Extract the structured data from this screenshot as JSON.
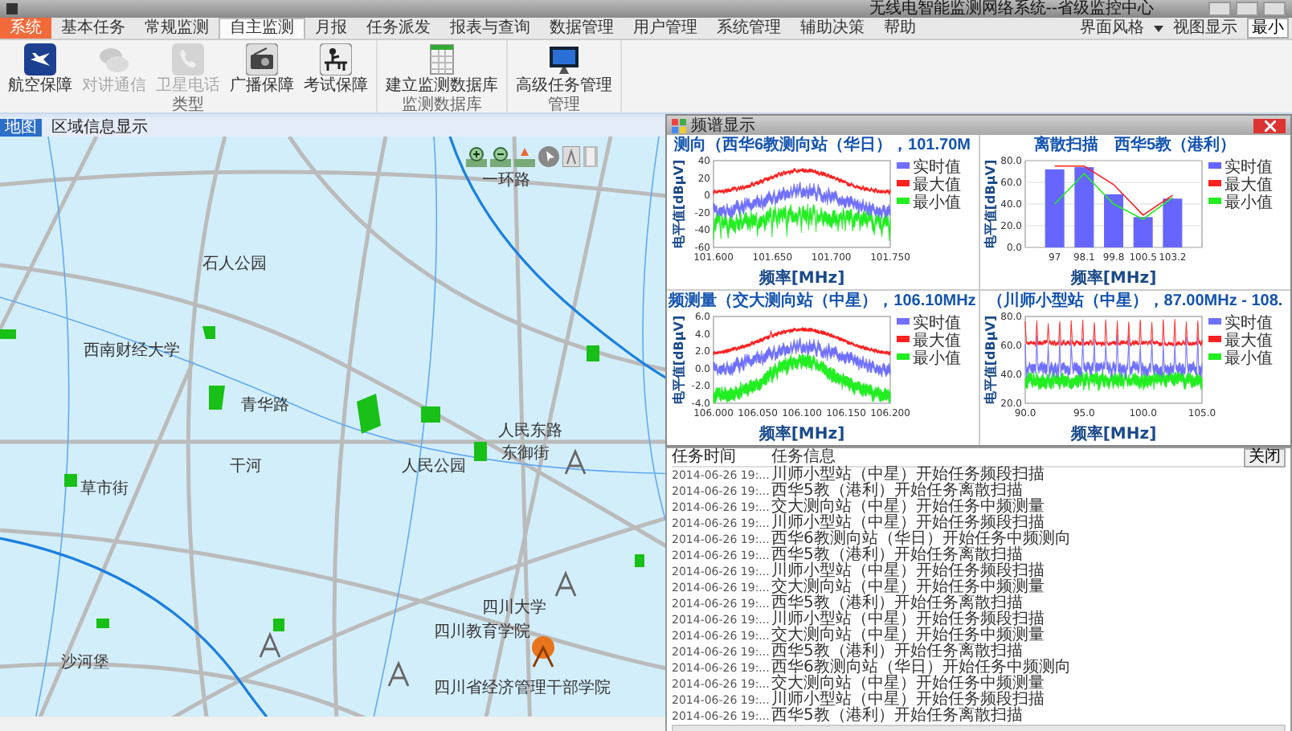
{
  "window": {
    "title": "无线电智能监测网络系统--省级监控中心"
  },
  "menu_tabs": [
    {
      "label": "系统",
      "kind": "app",
      "selected": false
    },
    {
      "label": "基本任务",
      "kind": "tab",
      "selected": false
    },
    {
      "label": "常规监测",
      "kind": "tab",
      "selected": false
    },
    {
      "label": "自主监测",
      "kind": "tab",
      "selected": true
    },
    {
      "label": "月报",
      "kind": "tab",
      "selected": false
    },
    {
      "label": "任务派发",
      "kind": "tab",
      "selected": false
    },
    {
      "label": "报表与查询",
      "kind": "tab",
      "selected": false
    },
    {
      "label": "数据管理",
      "kind": "tab",
      "selected": false
    },
    {
      "label": "用户管理",
      "kind": "tab",
      "selected": false
    },
    {
      "label": "系统管理",
      "kind": "tab",
      "selected": false
    },
    {
      "label": "辅助决策",
      "kind": "tab",
      "selected": false
    },
    {
      "label": "帮助",
      "kind": "tab",
      "selected": false
    }
  ],
  "toolbar_right": {
    "style_menu": "界面风格",
    "view_menu": "视图显示",
    "minimize": "最小"
  },
  "ribbon_groups": [
    {
      "label": "类型",
      "buttons": [
        {
          "label": "航空保障",
          "disabled": false
        },
        {
          "label": "对讲通信",
          "disabled": true
        },
        {
          "label": "卫星电话",
          "disabled": true
        },
        {
          "label": "广播保障",
          "disabled": false
        },
        {
          "label": "考试保障",
          "disabled": false
        }
      ]
    },
    {
      "label": "监测数据库",
      "buttons": [
        {
          "label": "建立监测数据库",
          "disabled": false
        }
      ]
    },
    {
      "label": "管理",
      "buttons": [
        {
          "label": "高级任务管理",
          "disabled": false
        }
      ]
    }
  ],
  "doc_bar": {
    "tab": "地图",
    "title": "区域信息显示"
  },
  "map": {
    "labels": [
      "一环路",
      "石人公园",
      "西南财经大学",
      "青华路",
      "人民公园",
      "人民东路",
      "东御街",
      "草市街",
      "干河",
      "四川大学",
      "四川教育学院",
      "四川省经济管理干部学院",
      "沙河堡"
    ]
  },
  "spectrum_window": {
    "title": "频谱显示",
    "charts": [
      {
        "kind": "peak",
        "title": "测向（西华6教测向站（华日），101.70M",
        "y_axis_title": "电平值[dBμV]",
        "x_axis_title": "频率[MHz]",
        "yticks": [
          "40",
          "20",
          "0",
          "-20",
          "-40",
          "-60"
        ],
        "xticks": [
          "101.600",
          "101.650",
          "101.700",
          "101.750"
        ],
        "legend": [
          {
            "name": "实时值",
            "color": "#7070ff"
          },
          {
            "name": "最大值",
            "color": "#ff2020"
          },
          {
            "name": "最小值",
            "color": "#22ee22"
          }
        ]
      },
      {
        "kind": "bar",
        "title": "离散扫描　西华5教（港利）",
        "y_axis_title": "电平值[dBμV]",
        "x_axis_title": "频率[MHz]",
        "chart_data": {
          "type": "bar",
          "grid": true,
          "legend": "right",
          "categories": [
            "97",
            "98.1",
            "99.8",
            "100.5",
            "103.2"
          ],
          "ylim": [
            0,
            80
          ],
          "yticks": [
            {
              "value": 0,
              "label": "0.0"
            },
            {
              "value": 20,
              "label": "20.0"
            },
            {
              "value": 40,
              "label": "40.0"
            },
            {
              "value": 60,
              "label": "60.0"
            },
            {
              "value": 80,
              "label": "80.0"
            }
          ],
          "series": [
            {
              "name": "实时值",
              "type": "bar",
              "color": "#6666ff",
              "values": [
                72,
                74,
                49,
                28,
                45
              ]
            },
            {
              "name": "最大值",
              "type": "line",
              "color": "#ff2020",
              "values": [
                75,
                75,
                58,
                30,
                48
              ]
            },
            {
              "name": "最小值",
              "type": "line",
              "color": "#22ee22",
              "values": [
                40,
                68,
                40,
                26,
                46
              ]
            }
          ]
        }
      },
      {
        "kind": "hump",
        "title": "频测量（交大测向站（中星），106.10MHz",
        "y_axis_title": "电平值[dBμV]",
        "x_axis_title": "频率[MHz]",
        "yticks": [
          "6.0",
          "4.0",
          "2.0",
          "0.0",
          "-2.0",
          "-4.0"
        ],
        "xticks": [
          "106.000",
          "106.050",
          "106.100",
          "106.150",
          "106.200"
        ],
        "legend": [
          {
            "name": "实时值",
            "color": "#7070ff"
          },
          {
            "name": "最大值",
            "color": "#ff2020"
          },
          {
            "name": "最小值",
            "color": "#22ee22"
          }
        ]
      },
      {
        "kind": "spiky",
        "title": "（川师小型站（中星），87.00MHz - 108.",
        "y_axis_title": "电平值[dBμV]",
        "x_axis_title": "频率[MHz]",
        "yticks": [
          "80.0",
          "60.0",
          "40.0",
          "20.0"
        ],
        "xticks": [
          "90.0",
          "95.0",
          "100.0",
          "105.0"
        ],
        "legend": [
          {
            "name": "实时值",
            "color": "#7070ff"
          },
          {
            "name": "最大值",
            "color": "#ff2020"
          },
          {
            "name": "最小值",
            "color": "#22ee22"
          }
        ]
      }
    ]
  },
  "task_log": {
    "close": "关闭",
    "columns": [
      "任务时间",
      "任务信息"
    ],
    "rows": [
      {
        "time": "2014-06-26 19:...",
        "message": "川师小型站（中星）开始任务频段扫描"
      },
      {
        "time": "2014-06-26 19:...",
        "message": "西华5教（港利）开始任务离散扫描"
      },
      {
        "time": "2014-06-26 19:...",
        "message": "交大测向站（中星）开始任务中频测量"
      },
      {
        "time": "2014-06-26 19:...",
        "message": "川师小型站（中星）开始任务频段扫描"
      },
      {
        "time": "2014-06-26 19:...",
        "message": "西华6教测向站（华日）开始任务中频测向"
      },
      {
        "time": "2014-06-26 19:...",
        "message": "西华5教（港利）开始任务离散扫描"
      },
      {
        "time": "2014-06-26 19:...",
        "message": "川师小型站（中星）开始任务频段扫描"
      },
      {
        "time": "2014-06-26 19:...",
        "message": "交大测向站（中星）开始任务中频测量"
      },
      {
        "time": "2014-06-26 19:...",
        "message": "西华5教（港利）开始任务离散扫描"
      },
      {
        "time": "2014-06-26 19:...",
        "message": "川师小型站（中星）开始任务频段扫描"
      },
      {
        "time": "2014-06-26 19:...",
        "message": "交大测向站（中星）开始任务中频测量"
      },
      {
        "time": "2014-06-26 19:...",
        "message": "西华5教（港利）开始任务离散扫描"
      },
      {
        "time": "2014-06-26 19:...",
        "message": "西华6教测向站（华日）开始任务中频测向"
      },
      {
        "time": "2014-06-26 19:...",
        "message": "交大测向站（中星）开始任务中频测量"
      },
      {
        "time": "2014-06-26 19:...",
        "message": "川师小型站（中星）开始任务频段扫描"
      },
      {
        "time": "2014-06-26 19:...",
        "message": "西华5教（港利）开始任务离散扫描"
      }
    ]
  }
}
